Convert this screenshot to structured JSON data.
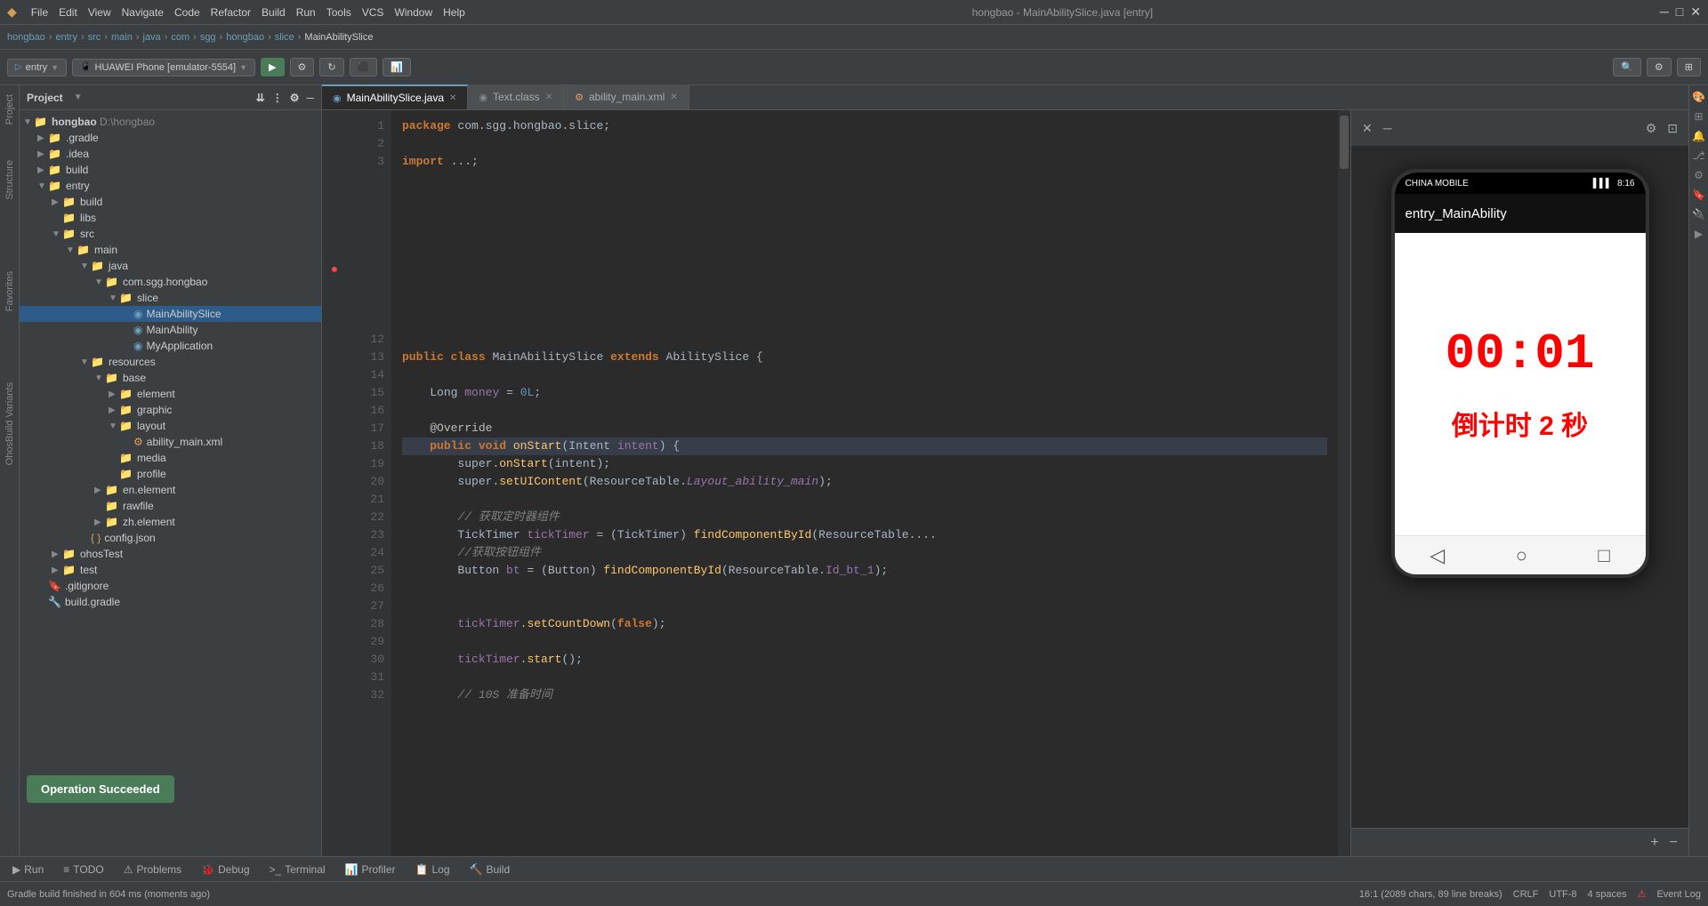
{
  "app": {
    "title": "hongbao - MainAbilitySlice.java [entry]"
  },
  "menubar": {
    "items": [
      "File",
      "Edit",
      "View",
      "Navigate",
      "Code",
      "Refactor",
      "Build",
      "Run",
      "Tools",
      "VCS",
      "Window",
      "Help"
    ]
  },
  "breadcrumb": {
    "parts": [
      "hongbao",
      "entry",
      "src",
      "main",
      "java",
      "com",
      "sgg",
      "hongbao",
      "slice",
      "MainAbilitySlice"
    ]
  },
  "toolbar": {
    "config_label": "entry",
    "device_label": "HUAWEI Phone [emulator-5554]",
    "run_label": "▶",
    "buttons": [
      "⚙",
      "◀▶",
      "↻",
      "⬛",
      "📁",
      "🔍",
      "⚙",
      "⊞"
    ]
  },
  "tabs": [
    {
      "label": "MainAbilitySlice.java",
      "active": true,
      "icon": "java-file"
    },
    {
      "label": "Text.class",
      "active": false,
      "icon": "class-file"
    },
    {
      "label": "ability_main.xml",
      "active": false,
      "icon": "xml-file"
    }
  ],
  "project_panel": {
    "header": "Project",
    "tree": [
      {
        "level": 0,
        "type": "folder",
        "label": "hongbao",
        "extra": "D:\\hongbao",
        "expanded": true
      },
      {
        "level": 1,
        "type": "folder",
        "label": ".gradle",
        "expanded": false
      },
      {
        "level": 1,
        "type": "folder",
        "label": ".idea",
        "expanded": false
      },
      {
        "level": 1,
        "type": "folder",
        "label": "build",
        "expanded": false
      },
      {
        "level": 1,
        "type": "folder",
        "label": "entry",
        "expanded": true
      },
      {
        "level": 2,
        "type": "folder",
        "label": "build",
        "expanded": false
      },
      {
        "level": 2,
        "type": "folder",
        "label": "libs",
        "expanded": false
      },
      {
        "level": 2,
        "type": "folder",
        "label": "src",
        "expanded": true
      },
      {
        "level": 3,
        "type": "folder",
        "label": "main",
        "expanded": true
      },
      {
        "level": 4,
        "type": "folder",
        "label": "java",
        "expanded": true
      },
      {
        "level": 5,
        "type": "folder",
        "label": "com.sgg.hongbao",
        "expanded": true
      },
      {
        "level": 6,
        "type": "folder",
        "label": "slice",
        "expanded": true
      },
      {
        "level": 7,
        "type": "file-java",
        "label": "MainAbilitySlice",
        "selected": true
      },
      {
        "level": 7,
        "type": "file-java",
        "label": "MainAbility"
      },
      {
        "level": 7,
        "type": "file-java",
        "label": "MyApplication"
      },
      {
        "level": 4,
        "type": "folder",
        "label": "resources",
        "expanded": true
      },
      {
        "level": 5,
        "type": "folder",
        "label": "base",
        "expanded": true
      },
      {
        "level": 6,
        "type": "folder",
        "label": "element",
        "expanded": false
      },
      {
        "level": 6,
        "type": "folder",
        "label": "graphic",
        "expanded": false
      },
      {
        "level": 6,
        "type": "folder",
        "label": "layout",
        "expanded": true
      },
      {
        "level": 7,
        "type": "file-xml",
        "label": "ability_main.xml"
      },
      {
        "level": 6,
        "type": "folder",
        "label": "media",
        "expanded": false
      },
      {
        "level": 6,
        "type": "folder",
        "label": "profile",
        "expanded": false
      },
      {
        "level": 5,
        "type": "folder",
        "label": "en.element",
        "expanded": false
      },
      {
        "level": 5,
        "type": "folder",
        "label": "rawfile",
        "expanded": false
      },
      {
        "level": 5,
        "type": "folder",
        "label": "zh.element",
        "expanded": false
      },
      {
        "level": 4,
        "type": "file-json",
        "label": "config.json"
      },
      {
        "level": 2,
        "type": "folder",
        "label": "ohosTest",
        "expanded": false
      },
      {
        "level": 2,
        "type": "folder",
        "label": "test",
        "expanded": false
      },
      {
        "level": 1,
        "type": "file-git",
        "label": ".gitignore"
      },
      {
        "level": 1,
        "type": "file-gradle",
        "label": "build.gradle"
      }
    ]
  },
  "code": {
    "lines": [
      {
        "num": 1,
        "content": "package com.sgg.hongbao.slice;"
      },
      {
        "num": 2,
        "content": ""
      },
      {
        "num": 3,
        "content": "import ...;"
      },
      {
        "num": 12,
        "content": ""
      },
      {
        "num": 13,
        "content": "public class MainAbilitySlice extends AbilitySlice {"
      },
      {
        "num": 14,
        "content": ""
      },
      {
        "num": 15,
        "content": "    Long money = 0L;"
      },
      {
        "num": 16,
        "content": ""
      },
      {
        "num": 17,
        "content": "    @Override"
      },
      {
        "num": 18,
        "content": "    public void onStart(Intent intent) {"
      },
      {
        "num": 19,
        "content": "        super.onStart(intent);"
      },
      {
        "num": 20,
        "content": "        super.setUIContent(ResourceTable.Layout_ability_main);"
      },
      {
        "num": 21,
        "content": ""
      },
      {
        "num": 22,
        "content": "        // 获取定时器组件"
      },
      {
        "num": 23,
        "content": "        TickTimer tickTimer = (TickTimer) findComponentById(ResourceTable...."
      },
      {
        "num": 24,
        "content": "        //获取按钮组件"
      },
      {
        "num": 25,
        "content": "        Button bt = (Button) findComponentById(ResourceTable.Id_bt_1);"
      },
      {
        "num": 26,
        "content": ""
      },
      {
        "num": 27,
        "content": ""
      },
      {
        "num": 28,
        "content": "        tickTimer.setCountDown(false);"
      },
      {
        "num": 29,
        "content": ""
      },
      {
        "num": 30,
        "content": "        tickTimer.start();"
      },
      {
        "num": 31,
        "content": ""
      },
      {
        "num": 32,
        "content": "        // 10S 准备时间"
      }
    ]
  },
  "emulator": {
    "carrier": "CHINA MOBILE",
    "time": "8:16",
    "title": "entry_MainAbility",
    "timer_value": "00:01",
    "timer_label": "倒计时 2 秒",
    "nav_back": "◁",
    "nav_home": "○",
    "nav_recent": "□"
  },
  "bottom_tabs": [
    {
      "label": "Run",
      "icon": "▶",
      "active": false
    },
    {
      "label": "TODO",
      "icon": "≡",
      "active": false
    },
    {
      "label": "Problems",
      "icon": "⚠",
      "active": false
    },
    {
      "label": "Debug",
      "icon": "🐛",
      "active": false
    },
    {
      "label": "Terminal",
      "icon": ">_",
      "active": false
    },
    {
      "label": "Profiler",
      "icon": "📊",
      "active": false
    },
    {
      "label": "Log",
      "icon": "📋",
      "active": false
    },
    {
      "label": "Build",
      "icon": "🔨",
      "active": false
    }
  ],
  "status_bar": {
    "left": "Gradle build finished in 604 ms (moments ago)",
    "position": "16:1 (2089 chars, 89 line breaks)",
    "encoding": "CRLF",
    "charset": "UTF-8",
    "indent": "4 spaces",
    "event_log": "Event Log"
  },
  "notification": {
    "text": "Operation Succeeded"
  },
  "side_tabs": {
    "project_icon": "Project",
    "structure": "Structure",
    "favorites": "Favorites",
    "ohos_build": "OhosBuild Variants"
  },
  "colors": {
    "accent": "#6a9dba",
    "bg_editor": "#2b2b2b",
    "bg_panel": "#3c3f41",
    "bg_selected": "#2d5c8a",
    "keyword": "#cc7832",
    "string": "#6a8759",
    "comment": "#808080",
    "number": "#6897bb",
    "function": "#ffc66d",
    "success": "#4a7c59",
    "timer_color": "#ff0000"
  }
}
